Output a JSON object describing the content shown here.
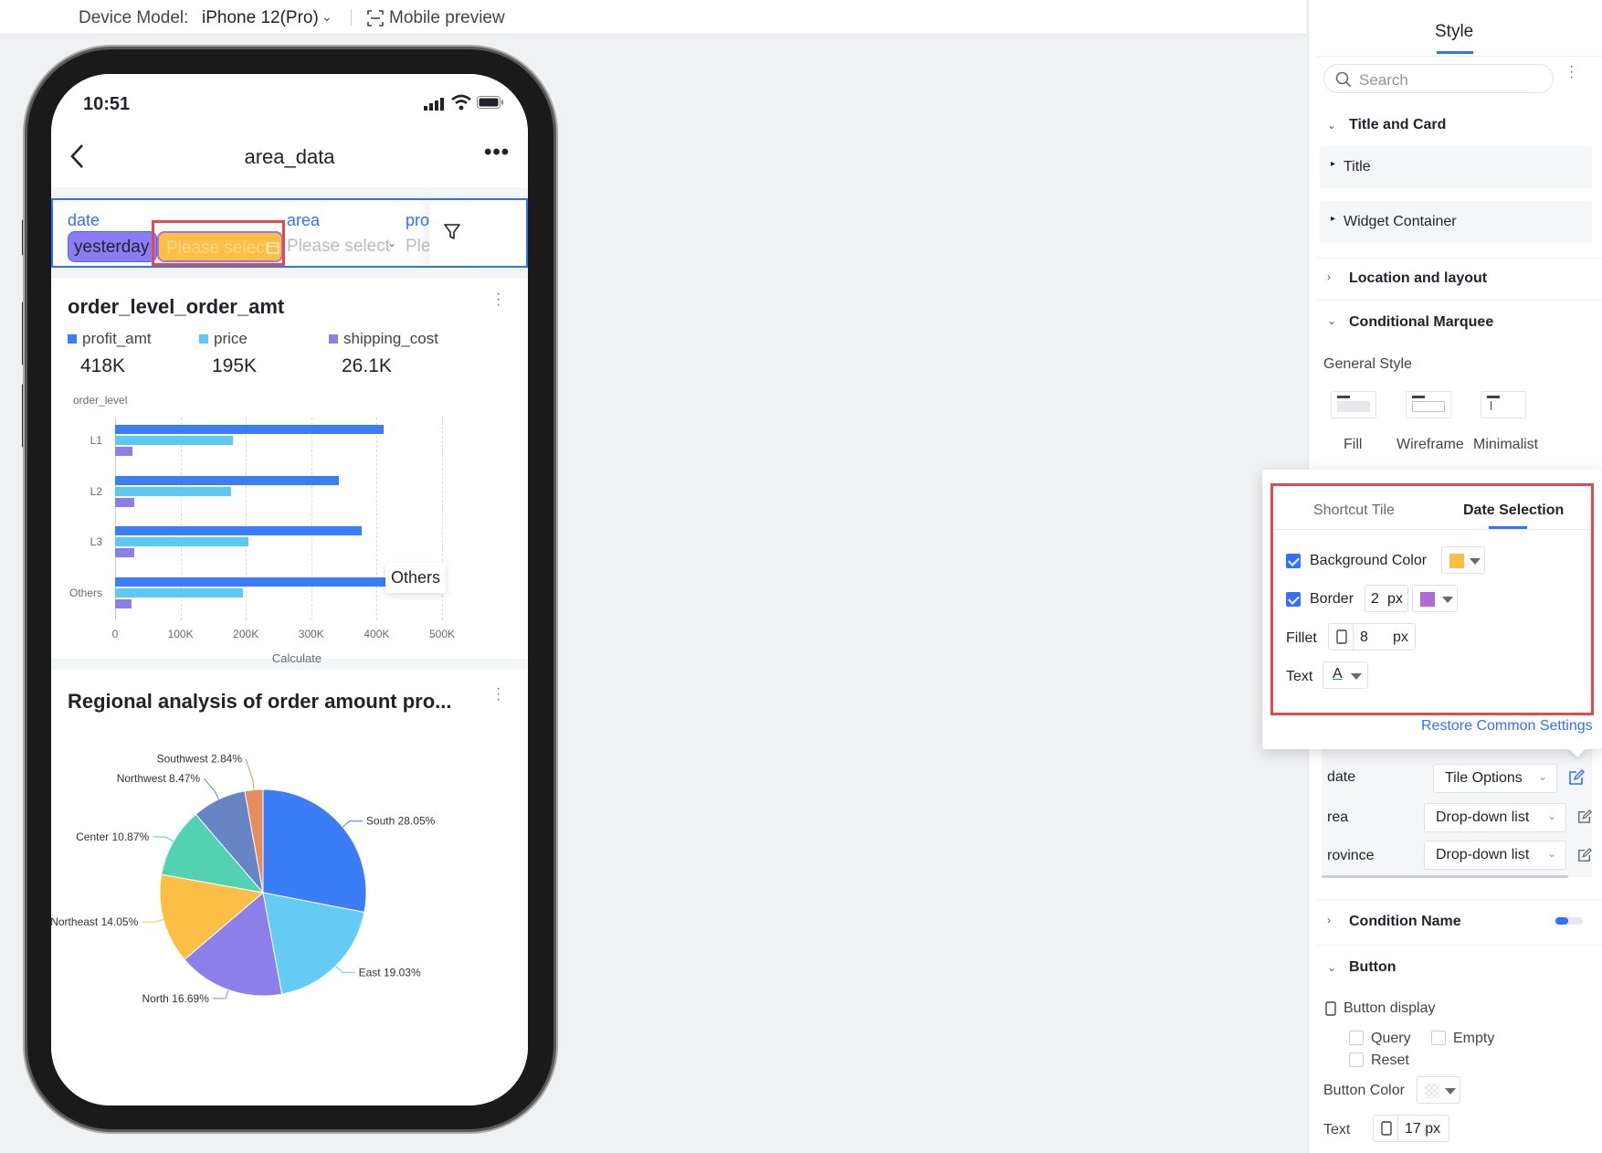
{
  "topbar": {
    "device_label": "Device Model:",
    "device_value": "iPhone 12(Pro)",
    "mobile_preview": "Mobile preview"
  },
  "phone": {
    "time": "10:51",
    "page_title": "area_data",
    "filters": {
      "date_label": "date",
      "date_chip": "yesterday",
      "date_placeholder": "Please select",
      "area_label": "area",
      "area_placeholder": "Please select",
      "pro_label": "pro",
      "pro_placeholder": "Ple"
    },
    "colors": {
      "chip_bg": "#8b7cf6",
      "highlight_bg": "#fbbf45",
      "accent": "#3370ff",
      "callout_border": "#e5484d"
    }
  },
  "bar_card": {
    "title": "order_level_order_amt",
    "metrics": [
      {
        "name": "profit_amt",
        "value": "418K",
        "color": "#3b7cf7"
      },
      {
        "name": "price",
        "value": "195K",
        "color": "#5cc8f3"
      },
      {
        "name": "shipping_cost",
        "value": "26.1K",
        "color": "#8c7fea"
      }
    ],
    "tooltip": "Others"
  },
  "chart_data": [
    {
      "type": "bar",
      "orientation": "horizontal",
      "title": "order_level_order_amt",
      "ylabel": "order_level",
      "xlabel": "Calculate",
      "categories": [
        "L1",
        "L2",
        "L3",
        "Others"
      ],
      "series": [
        {
          "name": "profit_amt",
          "values": [
            410000,
            342000,
            377000,
            417000
          ]
        },
        {
          "name": "price",
          "values": [
            180000,
            177000,
            204000,
            195000
          ]
        },
        {
          "name": "shipping_cost",
          "values": [
            26000,
            29000,
            29000,
            25000
          ]
        }
      ],
      "xlim": [
        0,
        500000
      ],
      "xticks": [
        "0",
        "100K",
        "200K",
        "300K",
        "400K",
        "500K"
      ],
      "grid": true
    },
    {
      "type": "pie",
      "title": "Regional analysis of order amount pro...",
      "categories": [
        "South",
        "East",
        "North",
        "Northeast",
        "Center",
        "Northwest",
        "Southwest"
      ],
      "values": [
        28.05,
        19.03,
        16.69,
        14.05,
        10.87,
        8.47,
        2.84
      ],
      "labels": [
        "South 28.05%",
        "East 19.03%",
        "North 16.69%",
        "Northeast 14.05%",
        "Center 10.87%",
        "Northwest 8.47%",
        "Southwest 2.84%"
      ],
      "colors": [
        "#3b7cf7",
        "#63cbf4",
        "#8c7fea",
        "#fbbf45",
        "#52d1b3",
        "#6784c5",
        "#e58e5d"
      ]
    }
  ],
  "right_panel": {
    "tab": "Style",
    "search_placeholder": "Search",
    "title_and_card": "Title and Card",
    "title_item": "Title",
    "widget_container": "Widget Container",
    "location_layout": "Location and layout",
    "conditional_marquee": "Conditional Marquee",
    "general_style": "General Style",
    "styles": [
      "Fill",
      "Wireframe",
      "Minimalist"
    ],
    "field_rows": [
      {
        "name": "date",
        "control": "Tile Options"
      },
      {
        "name": "rea",
        "control": "Drop-down list"
      },
      {
        "name": "rovince",
        "control": "Drop-down list"
      }
    ],
    "condition_name": "Condition Name",
    "button_section": "Button",
    "button_display": "Button display",
    "button_options": [
      "Query",
      "Empty",
      "Reset"
    ],
    "button_color": "Button Color",
    "text_label": "Text",
    "text_size": "17 px"
  },
  "popover": {
    "tabs": [
      "Shortcut Tile",
      "Date Selection"
    ],
    "background_color": "Background Color",
    "border": "Border",
    "border_value": "2",
    "px": "px",
    "fillet": "Fillet",
    "fillet_value": "8",
    "text": "Text",
    "text_glyph": "A",
    "restore": "Restore Common Settings",
    "colors": {
      "bg_swatch": "#fbbf45",
      "border_swatch": "#b06ad8"
    }
  }
}
